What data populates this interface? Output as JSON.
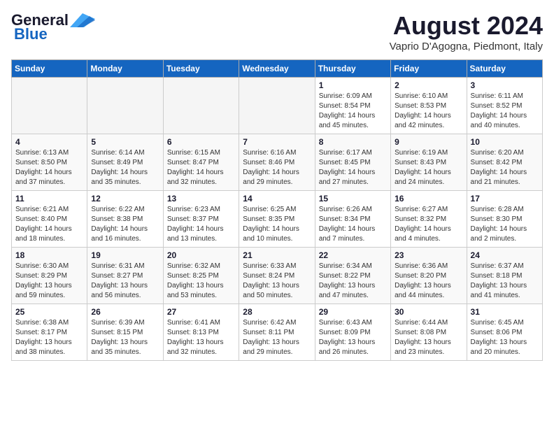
{
  "header": {
    "logo_line1": "General",
    "logo_line2": "Blue",
    "month": "August 2024",
    "location": "Vaprio D'Agogna, Piedmont, Italy"
  },
  "weekdays": [
    "Sunday",
    "Monday",
    "Tuesday",
    "Wednesday",
    "Thursday",
    "Friday",
    "Saturday"
  ],
  "weeks": [
    [
      {
        "day": "",
        "info": ""
      },
      {
        "day": "",
        "info": ""
      },
      {
        "day": "",
        "info": ""
      },
      {
        "day": "",
        "info": ""
      },
      {
        "day": "1",
        "info": "Sunrise: 6:09 AM\nSunset: 8:54 PM\nDaylight: 14 hours\nand 45 minutes."
      },
      {
        "day": "2",
        "info": "Sunrise: 6:10 AM\nSunset: 8:53 PM\nDaylight: 14 hours\nand 42 minutes."
      },
      {
        "day": "3",
        "info": "Sunrise: 6:11 AM\nSunset: 8:52 PM\nDaylight: 14 hours\nand 40 minutes."
      }
    ],
    [
      {
        "day": "4",
        "info": "Sunrise: 6:13 AM\nSunset: 8:50 PM\nDaylight: 14 hours\nand 37 minutes."
      },
      {
        "day": "5",
        "info": "Sunrise: 6:14 AM\nSunset: 8:49 PM\nDaylight: 14 hours\nand 35 minutes."
      },
      {
        "day": "6",
        "info": "Sunrise: 6:15 AM\nSunset: 8:47 PM\nDaylight: 14 hours\nand 32 minutes."
      },
      {
        "day": "7",
        "info": "Sunrise: 6:16 AM\nSunset: 8:46 PM\nDaylight: 14 hours\nand 29 minutes."
      },
      {
        "day": "8",
        "info": "Sunrise: 6:17 AM\nSunset: 8:45 PM\nDaylight: 14 hours\nand 27 minutes."
      },
      {
        "day": "9",
        "info": "Sunrise: 6:19 AM\nSunset: 8:43 PM\nDaylight: 14 hours\nand 24 minutes."
      },
      {
        "day": "10",
        "info": "Sunrise: 6:20 AM\nSunset: 8:42 PM\nDaylight: 14 hours\nand 21 minutes."
      }
    ],
    [
      {
        "day": "11",
        "info": "Sunrise: 6:21 AM\nSunset: 8:40 PM\nDaylight: 14 hours\nand 18 minutes."
      },
      {
        "day": "12",
        "info": "Sunrise: 6:22 AM\nSunset: 8:38 PM\nDaylight: 14 hours\nand 16 minutes."
      },
      {
        "day": "13",
        "info": "Sunrise: 6:23 AM\nSunset: 8:37 PM\nDaylight: 14 hours\nand 13 minutes."
      },
      {
        "day": "14",
        "info": "Sunrise: 6:25 AM\nSunset: 8:35 PM\nDaylight: 14 hours\nand 10 minutes."
      },
      {
        "day": "15",
        "info": "Sunrise: 6:26 AM\nSunset: 8:34 PM\nDaylight: 14 hours\nand 7 minutes."
      },
      {
        "day": "16",
        "info": "Sunrise: 6:27 AM\nSunset: 8:32 PM\nDaylight: 14 hours\nand 4 minutes."
      },
      {
        "day": "17",
        "info": "Sunrise: 6:28 AM\nSunset: 8:30 PM\nDaylight: 14 hours\nand 2 minutes."
      }
    ],
    [
      {
        "day": "18",
        "info": "Sunrise: 6:30 AM\nSunset: 8:29 PM\nDaylight: 13 hours\nand 59 minutes."
      },
      {
        "day": "19",
        "info": "Sunrise: 6:31 AM\nSunset: 8:27 PM\nDaylight: 13 hours\nand 56 minutes."
      },
      {
        "day": "20",
        "info": "Sunrise: 6:32 AM\nSunset: 8:25 PM\nDaylight: 13 hours\nand 53 minutes."
      },
      {
        "day": "21",
        "info": "Sunrise: 6:33 AM\nSunset: 8:24 PM\nDaylight: 13 hours\nand 50 minutes."
      },
      {
        "day": "22",
        "info": "Sunrise: 6:34 AM\nSunset: 8:22 PM\nDaylight: 13 hours\nand 47 minutes."
      },
      {
        "day": "23",
        "info": "Sunrise: 6:36 AM\nSunset: 8:20 PM\nDaylight: 13 hours\nand 44 minutes."
      },
      {
        "day": "24",
        "info": "Sunrise: 6:37 AM\nSunset: 8:18 PM\nDaylight: 13 hours\nand 41 minutes."
      }
    ],
    [
      {
        "day": "25",
        "info": "Sunrise: 6:38 AM\nSunset: 8:17 PM\nDaylight: 13 hours\nand 38 minutes."
      },
      {
        "day": "26",
        "info": "Sunrise: 6:39 AM\nSunset: 8:15 PM\nDaylight: 13 hours\nand 35 minutes."
      },
      {
        "day": "27",
        "info": "Sunrise: 6:41 AM\nSunset: 8:13 PM\nDaylight: 13 hours\nand 32 minutes."
      },
      {
        "day": "28",
        "info": "Sunrise: 6:42 AM\nSunset: 8:11 PM\nDaylight: 13 hours\nand 29 minutes."
      },
      {
        "day": "29",
        "info": "Sunrise: 6:43 AM\nSunset: 8:09 PM\nDaylight: 13 hours\nand 26 minutes."
      },
      {
        "day": "30",
        "info": "Sunrise: 6:44 AM\nSunset: 8:08 PM\nDaylight: 13 hours\nand 23 minutes."
      },
      {
        "day": "31",
        "info": "Sunrise: 6:45 AM\nSunset: 8:06 PM\nDaylight: 13 hours\nand 20 minutes."
      }
    ]
  ]
}
